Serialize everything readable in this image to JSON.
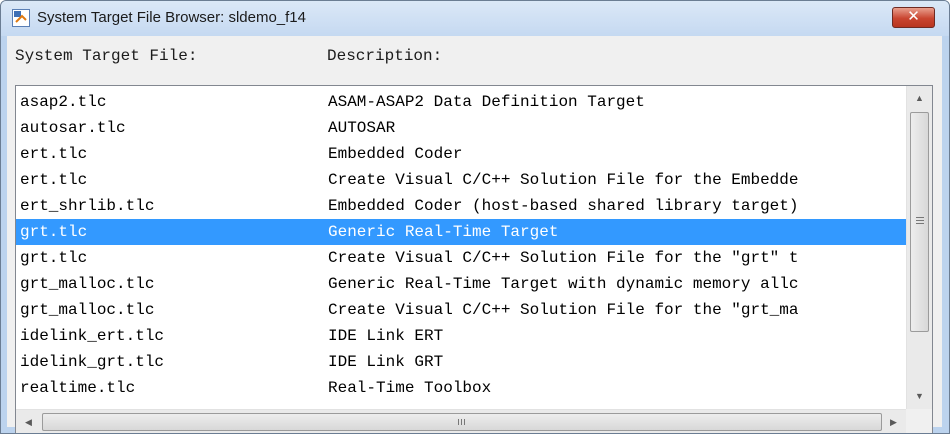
{
  "window": {
    "title": "System Target File Browser: sldemo_f14",
    "close_glyph": "✕"
  },
  "headers": {
    "file": "System Target File:",
    "description": "Description:"
  },
  "rows": [
    {
      "file": "asap2.tlc",
      "description": "ASAM-ASAP2 Data Definition Target"
    },
    {
      "file": "autosar.tlc",
      "description": "AUTOSAR"
    },
    {
      "file": "ert.tlc",
      "description": "Embedded Coder"
    },
    {
      "file": "ert.tlc",
      "description": "Create Visual C/C++ Solution File for the Embedde"
    },
    {
      "file": "ert_shrlib.tlc",
      "description": "Embedded Coder (host-based shared library target)"
    },
    {
      "file": "grt.tlc",
      "description": "Generic Real-Time Target",
      "selected": true
    },
    {
      "file": "grt.tlc",
      "description": "Create Visual C/C++ Solution File for the \"grt\" t"
    },
    {
      "file": "grt_malloc.tlc",
      "description": "Generic Real-Time Target with dynamic memory allc"
    },
    {
      "file": "grt_malloc.tlc",
      "description": "Create Visual C/C++ Solution File for the \"grt_ma"
    },
    {
      "file": "idelink_ert.tlc",
      "description": "IDE Link ERT"
    },
    {
      "file": "idelink_grt.tlc",
      "description": "IDE Link GRT"
    },
    {
      "file": "realtime.tlc",
      "description": "Real-Time Toolbox"
    }
  ],
  "scrollbars": {
    "up_glyph": "▲",
    "down_glyph": "▼",
    "left_glyph": "◀",
    "right_glyph": "▶"
  },
  "colors": {
    "selection": "#3399ff",
    "title_bar": "#c5d9f1",
    "close_button": "#c94530"
  },
  "icons": [
    "app-window-icon",
    "close-icon",
    "scroll-up-icon",
    "scroll-down-icon",
    "scroll-left-icon",
    "scroll-right-icon"
  ]
}
